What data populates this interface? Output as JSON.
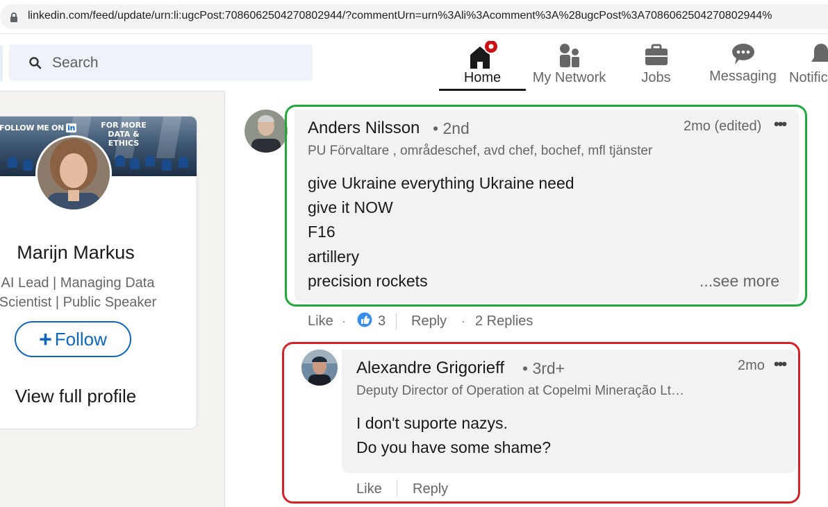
{
  "browser": {
    "url": "linkedin.com/feed/update/urn:li:ugcPost:7086062504270802944/?commentUrn=urn%3Ali%3Acomment%3A%28ugcPost%3A7086062504270802944%"
  },
  "nav": {
    "search_placeholder": "Search",
    "items": [
      {
        "label": "Home",
        "icon": "home-icon",
        "active": true,
        "badge": true
      },
      {
        "label": "My Network",
        "icon": "network-icon"
      },
      {
        "label": "Jobs",
        "icon": "briefcase-icon"
      },
      {
        "label": "Messaging",
        "icon": "messaging-icon"
      },
      {
        "label": "Notific",
        "icon": "bell-icon"
      }
    ]
  },
  "profile": {
    "banner_left": "FOLLOW ME ON",
    "banner_li": "in",
    "banner_right_1": "FOR MORE",
    "banner_right_2": "DATA & ETHICS",
    "name": "Marijn Markus",
    "headline_1": "AI Lead | Managing Data",
    "headline_2": "Scientist | Public Speaker",
    "follow_label": "Follow",
    "view_profile_label": "View full profile"
  },
  "comment": {
    "author": "Anders Nilsson",
    "degree": "• 2nd",
    "time": "2mo (edited)",
    "menu": "•••",
    "headline": "PU Förvaltare , områdeschef, avd chef, bochef, mfl tjänster",
    "lines": [
      "give Ukraine everything Ukraine need",
      "give it NOW",
      "F16",
      "artillery",
      "precision rockets"
    ],
    "see_more": "...see more",
    "like_label": "Like",
    "reaction_count": "3",
    "reply_label": "Reply",
    "replies_label": "2 Replies"
  },
  "reply": {
    "author": "Alexandre Grigorieff",
    "degree": "• 3rd+",
    "time": "2mo",
    "menu": "•••",
    "headline": "Deputy Director of Operation at Copelmi Mineração Lt…",
    "lines": [
      "I don't suporte nazys.",
      "Do you have some shame?"
    ],
    "like_label": "Like",
    "reply_label": "Reply"
  },
  "colors": {
    "linkedin_blue": "#0a66c2",
    "notification_red": "#cc1016",
    "green_frame": "#1eaa3b",
    "red_frame": "#d82028"
  }
}
